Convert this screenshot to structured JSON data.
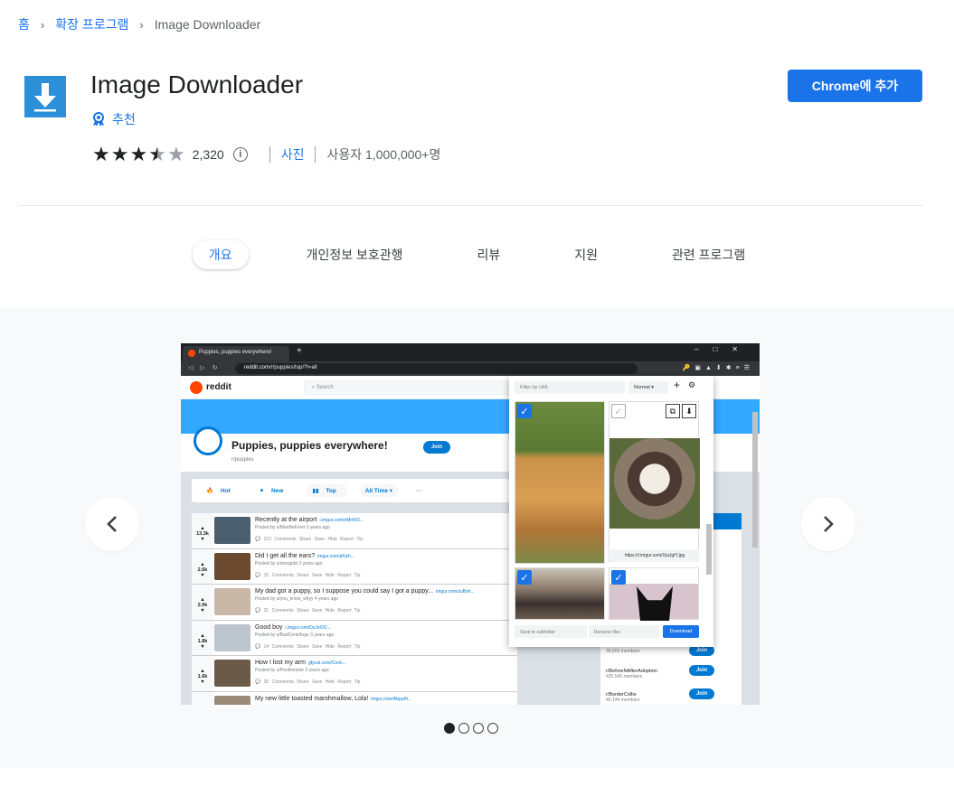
{
  "breadcrumb": {
    "home": "홈",
    "extensions": "확장 프로그램",
    "current": "Image Downloader"
  },
  "extension": {
    "title": "Image Downloader",
    "featured_label": "추천",
    "rating_count": "2,320",
    "rating_value": 4.5,
    "category": "사진",
    "users": "사용자 1,000,000+명",
    "add_button": "Chrome에 추가",
    "icon_name": "download-arrow-icon"
  },
  "tabs": [
    {
      "label": "개요",
      "active": true
    },
    {
      "label": "개인정보 보호관행"
    },
    {
      "label": "리뷰"
    },
    {
      "label": "지원"
    },
    {
      "label": "관련 프로그램"
    }
  ],
  "gallery": {
    "slides": 4,
    "active_slide": 1,
    "screenshot": {
      "browser_tab": "Puppies, puppies everywhere!",
      "url_host": "reddit.com",
      "url_path": "/r/puppies/top/?t=all",
      "site_name": "reddit",
      "search_placeholder": "Search",
      "subreddit_title": "Puppies, puppies everywhere!",
      "subreddit_path": "r/puppies",
      "join": "Join",
      "sort": [
        "Hot",
        "New",
        "Top",
        "All Time ▾",
        "···"
      ],
      "posts": [
        {
          "votes": "13.3k",
          "title": "Recently at the airport",
          "domain": "i.imgur.com/eMnW3...",
          "by": "Posted by u/ManBeForet 3 years ago",
          "comments": "213 Comments"
        },
        {
          "votes": "2.6k",
          "title": "Did I get all the ears?",
          "domain": "imgur.com/pFjzh...",
          "by": "Posted by u/stengebt 3 years ago",
          "comments": "15 Comments"
        },
        {
          "votes": "2.0k",
          "title": "My dad got a puppy, so I suppose you could say I got a puppy...",
          "domain": "imgur.com/zuBsh...",
          "by": "Posted by u/you_know_whyy 4 years ago",
          "comments": "31 Comments"
        },
        {
          "votes": "1.8k",
          "title": "Good boy",
          "domain": "i.imgur.com/DsJoOO...",
          "by": "Posted by u/BadCentrifuge 3 years ago",
          "comments": "14 Comments"
        },
        {
          "votes": "1.6k",
          "title": "How I lost my arm",
          "domain": "gfycat.com/Conn...",
          "by": "Posted by u/Prellmeister 3 years ago",
          "comments": "35 Comments"
        },
        {
          "votes": "",
          "title": "My new little toasted marshmallow, Lola!",
          "domain": "imgur.com/AbpyAt...",
          "by": "",
          "comments": ""
        }
      ],
      "post_actions": "Share   Save   Hide   Report   Tip",
      "sidebar": [
        {
          "name": "",
          "members": "30,603 members"
        },
        {
          "name": "r/BeforeNAfterAdoption",
          "members": "425,546 members"
        },
        {
          "name": "r/BorderCollie",
          "members": "46,144 members"
        }
      ],
      "popup": {
        "filter_placeholder": "Filter by URL",
        "mode": "Normal",
        "image_url": "https://i.imgur.com/XjaJgtY.jpg",
        "subfolder_placeholder": "Save to subfolder",
        "rename_placeholder": "Rename files",
        "download": "Download"
      }
    }
  }
}
